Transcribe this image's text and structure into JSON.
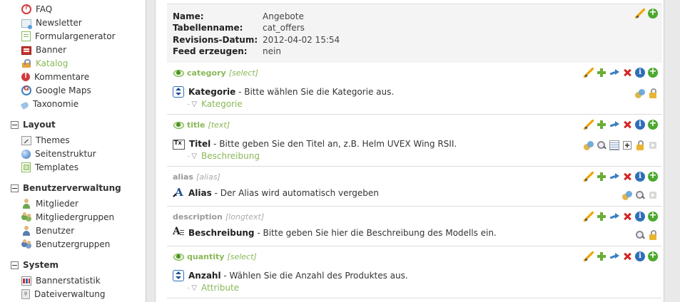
{
  "sidebar": {
    "items_top": [
      {
        "label": "FAQ",
        "icon": "faq-icon"
      },
      {
        "label": "Newsletter",
        "icon": "newsletter-icon"
      },
      {
        "label": "Formulargenerator",
        "icon": "form-generator-icon"
      },
      {
        "label": "Banner",
        "icon": "banner-icon"
      },
      {
        "label": "Katalog",
        "icon": "catalog-icon",
        "active": true
      },
      {
        "label": "Kommentare",
        "icon": "comments-icon"
      },
      {
        "label": "Google Maps",
        "icon": "google-maps-icon"
      },
      {
        "label": "Taxonomie",
        "icon": "taxonomy-icon"
      }
    ],
    "groups": [
      {
        "title": "Layout",
        "items": [
          {
            "label": "Themes",
            "icon": "themes-icon"
          },
          {
            "label": "Seitenstruktur",
            "icon": "site-structure-icon"
          },
          {
            "label": "Templates",
            "icon": "templates-icon"
          }
        ]
      },
      {
        "title": "Benutzerverwaltung",
        "items": [
          {
            "label": "Mitglieder",
            "icon": "member-icon"
          },
          {
            "label": "Mitgliedergruppen",
            "icon": "member-groups-icon"
          },
          {
            "label": "Benutzer",
            "icon": "user-icon"
          },
          {
            "label": "Benutzergruppen",
            "icon": "user-groups-icon"
          }
        ]
      },
      {
        "title": "System",
        "items": [
          {
            "label": "Bannerstatistik",
            "icon": "banner-stats-icon"
          },
          {
            "label": "Dateiverwaltung",
            "icon": "file-manager-icon"
          }
        ]
      }
    ]
  },
  "catalog": {
    "rows": [
      {
        "key": "Name:",
        "value": "Angebote"
      },
      {
        "key": "Tabellenname:",
        "value": "cat_offers"
      },
      {
        "key": "Revisions-Datum:",
        "value": "2012-04-02 15:54"
      },
      {
        "key": "Feed erzeugen:",
        "value": "nein"
      }
    ]
  },
  "fields": [
    {
      "name": "category",
      "type": "[select]",
      "visible": true,
      "title": "Kategorie",
      "description": " - Bitte wählen Sie die Kategorie aus.",
      "sub": "Kategorie"
    },
    {
      "name": "title",
      "type": "[text]",
      "visible": true,
      "title": "Titel",
      "description": " - Bitte geben Sie den Titel an, z.B. Helm UVEX Wing RSII.",
      "sub": "Beschreibung"
    },
    {
      "name": "alias",
      "type": "[alias]",
      "visible": false,
      "title": "Alias",
      "description": " - Der Alias wird automatisch vergeben",
      "sub": ""
    },
    {
      "name": "description",
      "type": "[longtext]",
      "visible": false,
      "title": "Beschreibung",
      "description": " - Bitte geben Sie hier die Beschreibung des Modells ein.",
      "sub": ""
    },
    {
      "name": "quantity",
      "type": "[select]",
      "visible": true,
      "title": "Anzahl",
      "description": " - Wählen Sie die Anzahl des Produktes aus.",
      "sub": "Attribute"
    }
  ],
  "colors": {
    "accent_green": "#8ab858",
    "grey_text": "#999999"
  }
}
